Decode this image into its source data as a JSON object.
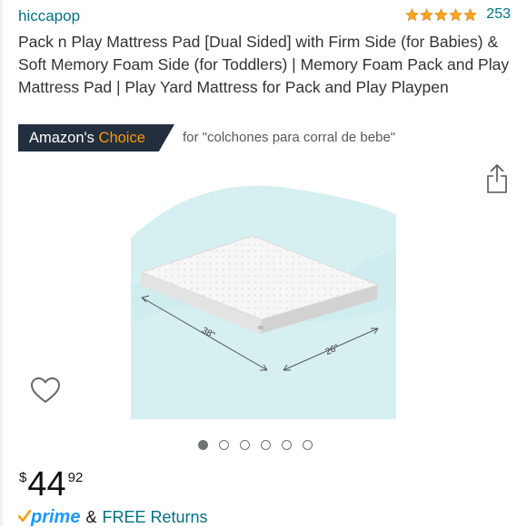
{
  "seller": {
    "brand": "hiccapop"
  },
  "rating": {
    "stars": 5,
    "count": "253",
    "star_color": "#ffa41c"
  },
  "product": {
    "title": "Pack n Play Mattress Pad [Dual Sided] with Firm Side (for Babies) & Soft Memory Foam Side (for Toddlers) | Memory Foam Pack and Play Mattress Pad | Play Yard Mattress for Pack and Play Playpen"
  },
  "badge": {
    "prefix": "Amazon's",
    "accent": "Choice",
    "query_text": "for \"colchones para corral de bebe\"",
    "accent_color": "#ff9900",
    "background_color": "#232f3e"
  },
  "image": {
    "dimension_long": "38\"",
    "dimension_short": "26\"",
    "carousel_count": 6,
    "carousel_active": 0,
    "background_color": "#d6eff0"
  },
  "price": {
    "currency": "$",
    "whole": "44",
    "fraction": "92"
  },
  "shipping": {
    "prime_label": "prime",
    "amp": "&",
    "returns_label": "FREE Returns",
    "prime_color": "#1a98ff"
  },
  "icons": {
    "share": "share-icon",
    "heart": "heart-icon",
    "star": "star-icon",
    "prime_check": "prime-check-icon"
  }
}
